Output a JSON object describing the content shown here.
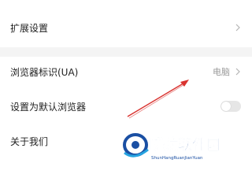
{
  "settings": {
    "extension": {
      "label": "扩展设置"
    },
    "user_agent": {
      "label": "浏览器标识(UA)",
      "value": "电脑"
    },
    "default_browser": {
      "label": "设置为默认浏览器",
      "enabled": false
    },
    "about": {
      "label": "关于我们"
    }
  },
  "watermark": {
    "title": "瞬航软件园",
    "subtitle": "ShunHangRuanJianYuan"
  },
  "colors": {
    "annotation_arrow": "#d9322f",
    "divider_gap": "#f4f4f4",
    "watermark_blue": "#1a4fa3"
  },
  "icons": {
    "chevron": "chevron-right-icon",
    "annotation": "arrow-annotation-icon"
  }
}
